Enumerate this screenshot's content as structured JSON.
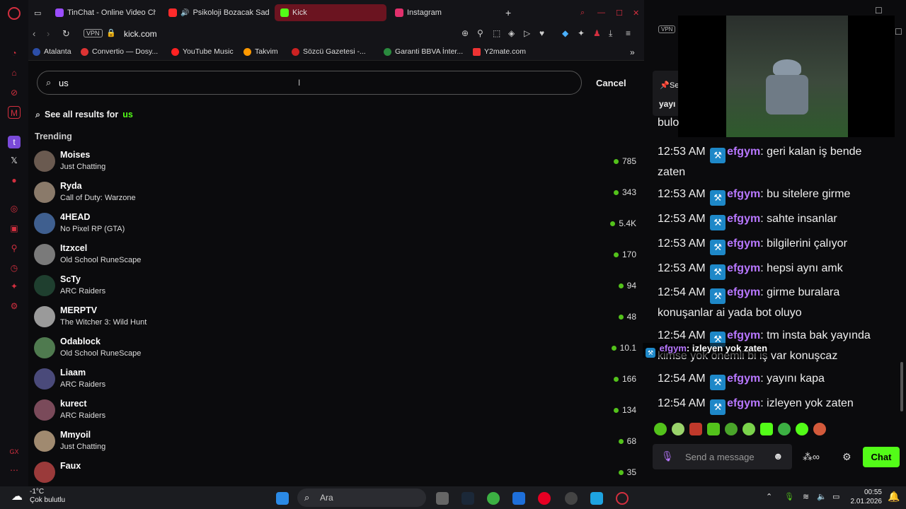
{
  "tabs": [
    {
      "label": "TinChat - Online Video Chat",
      "color": "#9b4dff"
    },
    {
      "label": "Psikoloji Bozacak Sad",
      "color": "#ff2b2b"
    },
    {
      "label": "Kick",
      "color": "#53fc18"
    },
    {
      "label": "Instagram",
      "color": "#e1306c"
    }
  ],
  "address": {
    "url": "kick.com",
    "vpn": "VPN"
  },
  "bookmarks": [
    "Atalanta",
    "Convertio — Dosy...",
    "YouTube Music",
    "Takvim",
    "Sözcü Gazetesi -...",
    "Garanti BBVA İnter...",
    "Y2mate.com"
  ],
  "search": {
    "value": "us",
    "cancel": "Cancel",
    "see_all_prefix": "See all results for",
    "see_all_term": "us"
  },
  "trending_heading": "Trending",
  "results": [
    {
      "name": "Moises",
      "category": "Just Chatting",
      "viewers": "785"
    },
    {
      "name": "Ryda",
      "category": "Call of Duty: Warzone",
      "viewers": "343"
    },
    {
      "name": "4HEAD",
      "category": "No Pixel RP (GTA)",
      "viewers": "5.4K"
    },
    {
      "name": "Itzxcel",
      "category": "Old School RuneScape",
      "viewers": "170"
    },
    {
      "name": "ScTy",
      "category": "ARC Raiders",
      "viewers": "94"
    },
    {
      "name": "MERPTV",
      "category": "The Witcher 3: Wild Hunt",
      "viewers": "48"
    },
    {
      "name": "Odablock",
      "category": "Old School RuneScape",
      "viewers": "10.1"
    },
    {
      "name": "Liaam",
      "category": "ARC Raiders",
      "viewers": "166"
    },
    {
      "name": "kurect",
      "category": "ARC Raiders",
      "viewers": "134"
    },
    {
      "name": "Mmyoil",
      "category": "Just Chatting",
      "viewers": "68"
    },
    {
      "name": "Faux",
      "category": "",
      "viewers": "35"
    }
  ],
  "chat": {
    "pinned_partial": [
      "Se",
      "yayı"
    ],
    "partial_line": "bulo",
    "messages": [
      {
        "time": "12:53 AM",
        "user": "efgym",
        "text": "geri kalan iş bende zaten"
      },
      {
        "time": "12:53 AM",
        "user": "efgym",
        "text": "bu sitelere girme"
      },
      {
        "time": "12:53 AM",
        "user": "efgym",
        "text": "sahte insanlar"
      },
      {
        "time": "12:53 AM",
        "user": "efgym",
        "text": "bilgilerini çalıyor"
      },
      {
        "time": "12:53 AM",
        "user": "efgym",
        "text": "hepsi aynı amk"
      },
      {
        "time": "12:54 AM",
        "user": "efgym",
        "text": "girme buralara konuşanlar ai yada bot oluyo"
      },
      {
        "time": "12:54 AM",
        "user": "efgym",
        "text": "tm insta bak yayında kimse yok önemli bi iş var konuşcaz"
      },
      {
        "time": "12:54 AM",
        "user": "efgym",
        "text": "yayını kapa"
      },
      {
        "time": "12:54 AM",
        "user": "efgym",
        "text": "izleyen yok zaten"
      }
    ],
    "overlay_user": "efgym",
    "overlay_text": ": izleyen yok zaten",
    "input_placeholder": "Send a message",
    "send_label": "Chat"
  },
  "taskbar": {
    "temp": "-1°C",
    "weather": "Çok bulutlu",
    "search": "Ara",
    "time": "00:55",
    "date": "2.01.2026"
  }
}
